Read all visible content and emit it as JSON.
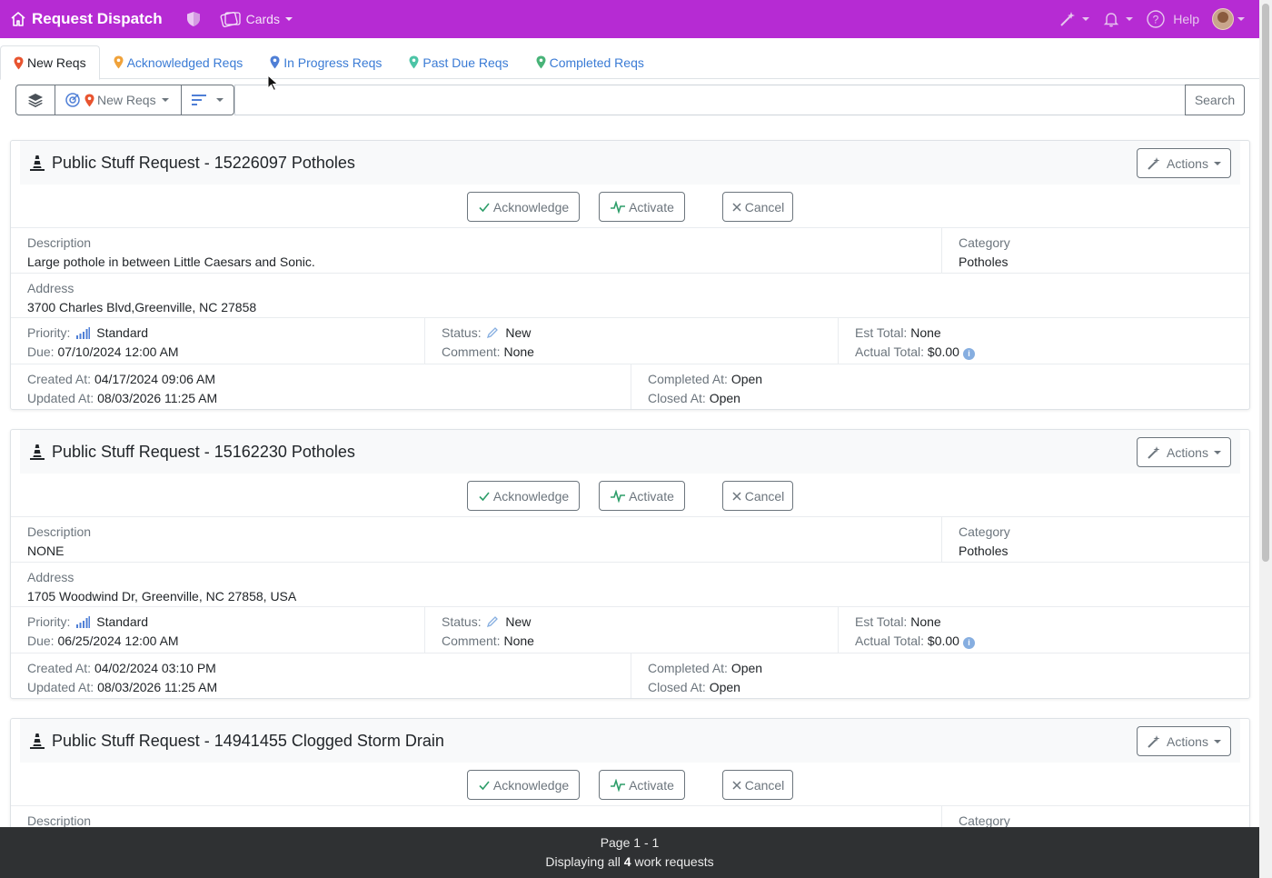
{
  "app": {
    "title": "Request Dispatch",
    "cards_label": "Cards",
    "help_label": "Help",
    "nav_color": "#b62bd3"
  },
  "tabs": [
    {
      "label": "New Reqs",
      "pin_color": "#e8542f",
      "active": true
    },
    {
      "label": "Acknowledged Reqs",
      "pin_color": "#f0a23a",
      "active": false
    },
    {
      "label": "In Progress Reqs",
      "pin_color": "#4f7fd6",
      "active": false
    },
    {
      "label": "Past Due Reqs",
      "pin_color": "#4cc4a6",
      "active": false
    },
    {
      "label": "Completed Reqs",
      "pin_color": "#48b378",
      "active": false
    }
  ],
  "toolbar": {
    "filter_label": "New Reqs",
    "search_value": "",
    "search_button": "Search"
  },
  "labels": {
    "actions": "Actions",
    "acknowledge": "Acknowledge",
    "activate": "Activate",
    "cancel": "Cancel",
    "description": "Description",
    "category": "Category",
    "address": "Address",
    "priority": "Priority:",
    "due": "Due:",
    "status": "Status:",
    "comment": "Comment:",
    "est_total": "Est Total:",
    "actual_total": "Actual Total:",
    "created_at": "Created At:",
    "updated_at": "Updated At:",
    "completed_at": "Completed At:",
    "closed_at": "Closed At:"
  },
  "cards": [
    {
      "title": "Public Stuff Request - 15226097 Potholes",
      "description": "Large pothole in between Little Caesars and Sonic.",
      "category": "Potholes",
      "address": "3700 Charles Blvd,Greenville, NC 27858",
      "priority": "Standard",
      "due": "07/10/2024 12:00 AM",
      "status": "New",
      "comment": "None",
      "est_total": "None",
      "actual_total": "$0.00",
      "created_at": "04/17/2024 09:06 AM",
      "updated_at": "08/03/2026 11:25 AM",
      "completed_at": "Open",
      "closed_at": "Open"
    },
    {
      "title": "Public Stuff Request - 15162230 Potholes",
      "description": "NONE",
      "category": "Potholes",
      "address": "1705 Woodwind Dr, Greenville, NC 27858, USA",
      "priority": "Standard",
      "due": "06/25/2024 12:00 AM",
      "status": "New",
      "comment": "None",
      "est_total": "None",
      "actual_total": "$0.00",
      "created_at": "04/02/2024 03:10 PM",
      "updated_at": "08/03/2026 11:25 AM",
      "completed_at": "Open",
      "closed_at": "Open"
    },
    {
      "title": "Public Stuff Request - 14941455 Clogged Storm Drain"
    }
  ],
  "footer": {
    "page_text": "Page 1 - 1",
    "display_prefix": "Displaying all",
    "display_count": "4",
    "display_suffix": "work requests"
  }
}
